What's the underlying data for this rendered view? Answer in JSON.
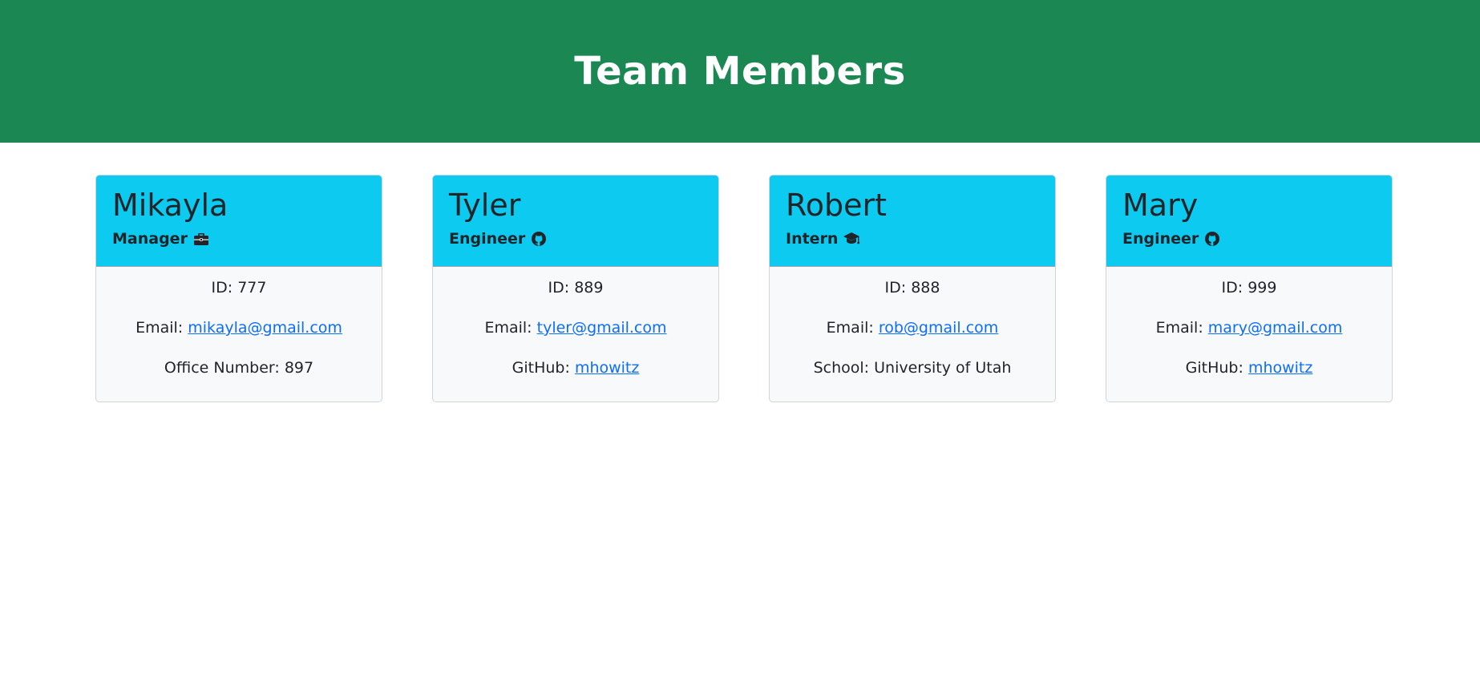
{
  "header": {
    "title": "Team Members"
  },
  "members": [
    {
      "name": "Mikayla",
      "role": "Manager",
      "icon": "briefcase-icon",
      "id_label": "ID:",
      "id": "777",
      "email_label": "Email:",
      "email": "mikayla@gmail.com",
      "extra_label": "Office Number:",
      "extra_value": "897"
    },
    {
      "name": "Tyler",
      "role": "Engineer",
      "icon": "github-icon",
      "id_label": "ID:",
      "id": "889",
      "email_label": "Email:",
      "email": "tyler@gmail.com",
      "extra_label": "GitHub:",
      "extra_value": "mhowitz"
    },
    {
      "name": "Robert",
      "role": "Intern",
      "icon": "graduation-cap-icon",
      "id_label": "ID:",
      "id": "888",
      "email_label": "Email:",
      "email": "rob@gmail.com",
      "extra_label": "School:",
      "extra_value": "University of Utah"
    },
    {
      "name": "Mary",
      "role": "Engineer",
      "icon": "github-icon",
      "id_label": "ID:",
      "id": "999",
      "email_label": "Email:",
      "email": "mary@gmail.com",
      "extra_label": "GitHub:",
      "extra_value": "mhowitz"
    }
  ],
  "colors": {
    "header_bg": "#1b8854",
    "card_head_bg": "#0dcaf0",
    "card_body_bg": "#f8f9fa",
    "link": "#0d6efd"
  }
}
